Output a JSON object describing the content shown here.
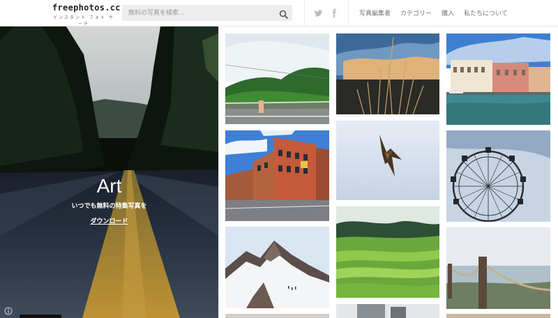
{
  "header": {
    "logo_title": "freephotos.cc",
    "logo_subtitle": "インスタント フォト サーチ",
    "search_placeholder": "無料の写真を検索...",
    "social_icons": [
      "twitter-icon",
      "facebook-icon"
    ],
    "nav": [
      {
        "label": "写真編集者"
      },
      {
        "label": "カテゴリー"
      },
      {
        "label": "購入"
      },
      {
        "label": "私たちについて"
      }
    ]
  },
  "hero": {
    "title": "Art",
    "subtitle": "いつでも無料の特集写真を",
    "download_label": "ダウンロード",
    "icons": [
      "info-icon"
    ]
  },
  "gallery": {
    "photos": [
      {
        "subject": "green hills and road"
      },
      {
        "subject": "dry grass at sunset"
      },
      {
        "subject": "venice canal palaces"
      },
      {
        "subject": "brick buildings street"
      },
      {
        "subject": "eagle in flight"
      },
      {
        "subject": "ferris wheel"
      },
      {
        "subject": "snowy mountain peak"
      },
      {
        "subject": "green rice terraces"
      },
      {
        "subject": "rope fence by sea"
      }
    ]
  },
  "colors": {
    "header_bg": "#ffffff",
    "nav_text": "#777777",
    "search_bg": "#ededed",
    "road_line": "#d7a43a"
  }
}
